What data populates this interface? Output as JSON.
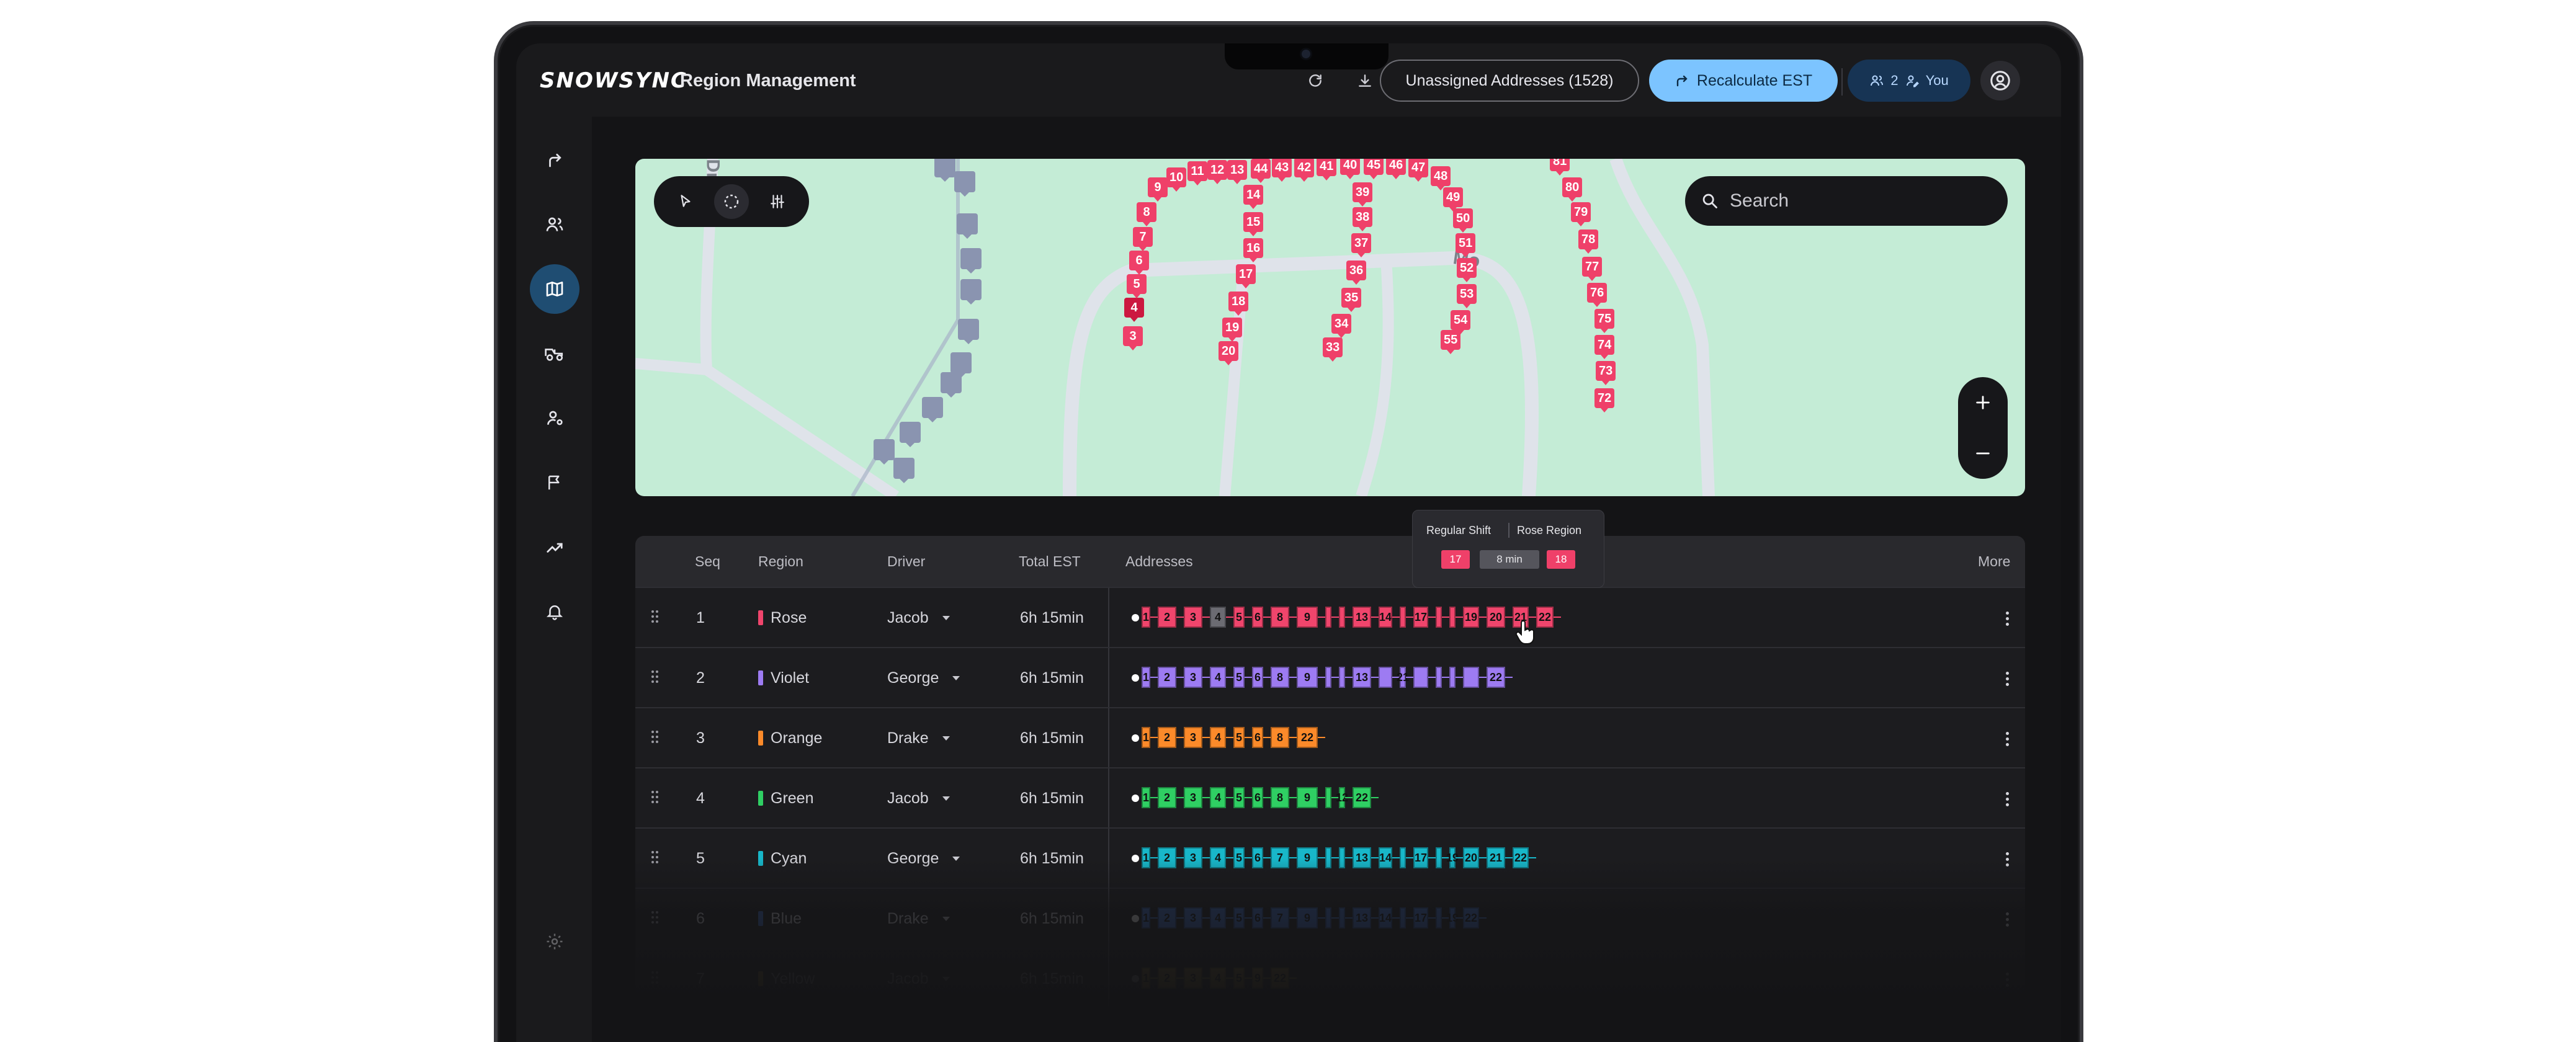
{
  "app": {
    "logo": "SNOWSYNC",
    "page_title": "Region Management"
  },
  "topbar": {
    "refresh_icon": "refresh-icon",
    "download_icon": "download-icon",
    "unassigned_label": "Unassigned Addresses (1528)",
    "recalculate_label": "Recalculate EST",
    "collab_count": "2",
    "you_label": "You"
  },
  "sidebar": {
    "items": [
      {
        "icon": "route-icon"
      },
      {
        "icon": "users-icon"
      },
      {
        "icon": "map-icon",
        "active": true
      },
      {
        "icon": "vehicles-icon"
      },
      {
        "icon": "user-settings-icon"
      },
      {
        "icon": "flag-icon"
      },
      {
        "icon": "analytics-icon"
      },
      {
        "icon": "bell-icon"
      },
      {
        "icon": "settings-icon"
      }
    ]
  },
  "map": {
    "search_placeholder": "Search",
    "street_labels": [
      "Dr",
      "Mo"
    ],
    "pins": [
      "3",
      "4",
      "5",
      "6",
      "7",
      "8",
      "9",
      "10",
      "11",
      "12",
      "13",
      "44",
      "43",
      "42",
      "41",
      "40",
      "45",
      "46",
      "47",
      "48",
      "49",
      "50",
      "51",
      "52",
      "53",
      "54",
      "55",
      "14",
      "15",
      "16",
      "17",
      "18",
      "19",
      "20",
      "39",
      "38",
      "37",
      "36",
      "35",
      "34",
      "33",
      "81",
      "80",
      "79",
      "78",
      "77",
      "76",
      "75",
      "74",
      "73",
      "72"
    ]
  },
  "tooltip": {
    "shift": "Regular Shift",
    "region": "Rose Region",
    "from": "17",
    "duration": "8 min",
    "to": "18"
  },
  "table": {
    "headers": {
      "seq": "Seq",
      "region": "Region",
      "driver": "Driver",
      "total_est": "Total EST",
      "addresses": "Addresses",
      "more": "More"
    },
    "rows": [
      {
        "seq": "1",
        "region": "Rose",
        "color": "#f0456c",
        "driver": "Jacob",
        "est": "6h 15min",
        "stops": [
          "1",
          "2",
          "3",
          "4",
          "5",
          "6",
          "8",
          "9",
          "",
          "",
          "13",
          "14",
          "",
          "17",
          "",
          "",
          "19",
          "20",
          "21",
          "22"
        ]
      },
      {
        "seq": "2",
        "region": "Violet",
        "color": "#9d7bf2",
        "driver": "George",
        "est": "6h 15min",
        "stops": [
          "1",
          "2",
          "3",
          "4",
          "5",
          "6",
          "8",
          "9",
          "",
          "",
          "13",
          "",
          "21",
          "",
          "",
          "",
          "",
          "22"
        ]
      },
      {
        "seq": "3",
        "region": "Orange",
        "color": "#fb8a2a",
        "driver": "Drake",
        "est": "6h 15min",
        "stops": [
          "1",
          "2",
          "3",
          "4",
          "5",
          "6",
          "8",
          "22"
        ]
      },
      {
        "seq": "4",
        "region": "Green",
        "color": "#2fcf63",
        "driver": "Jacob",
        "est": "6h 15min",
        "stops": [
          "1",
          "2",
          "3",
          "4",
          "5",
          "6",
          "8",
          "9",
          "",
          "12",
          "22"
        ]
      },
      {
        "seq": "5",
        "region": "Cyan",
        "color": "#18b7c9",
        "driver": "George",
        "est": "6h 15min",
        "stops": [
          "1",
          "2",
          "3",
          "4",
          "5",
          "6",
          "7",
          "9",
          "",
          "",
          "13",
          "14",
          "",
          "17",
          "",
          "19",
          "20",
          "21",
          "22"
        ]
      },
      {
        "seq": "6",
        "region": "Blue",
        "color": "#3f74d8",
        "driver": "Drake",
        "est": "6h 15min",
        "stops": [
          "1",
          "2",
          "3",
          "4",
          "5",
          "6",
          "7",
          "9",
          "",
          "",
          "13",
          "14",
          "",
          "17",
          "",
          "19",
          "22"
        ]
      },
      {
        "seq": "7",
        "region": "Yellow",
        "color": "#e6b92e",
        "driver": "Jacob",
        "est": "6h 15min",
        "stops": [
          "1",
          "2",
          "3",
          "4",
          "5",
          "9",
          "22"
        ]
      }
    ]
  }
}
